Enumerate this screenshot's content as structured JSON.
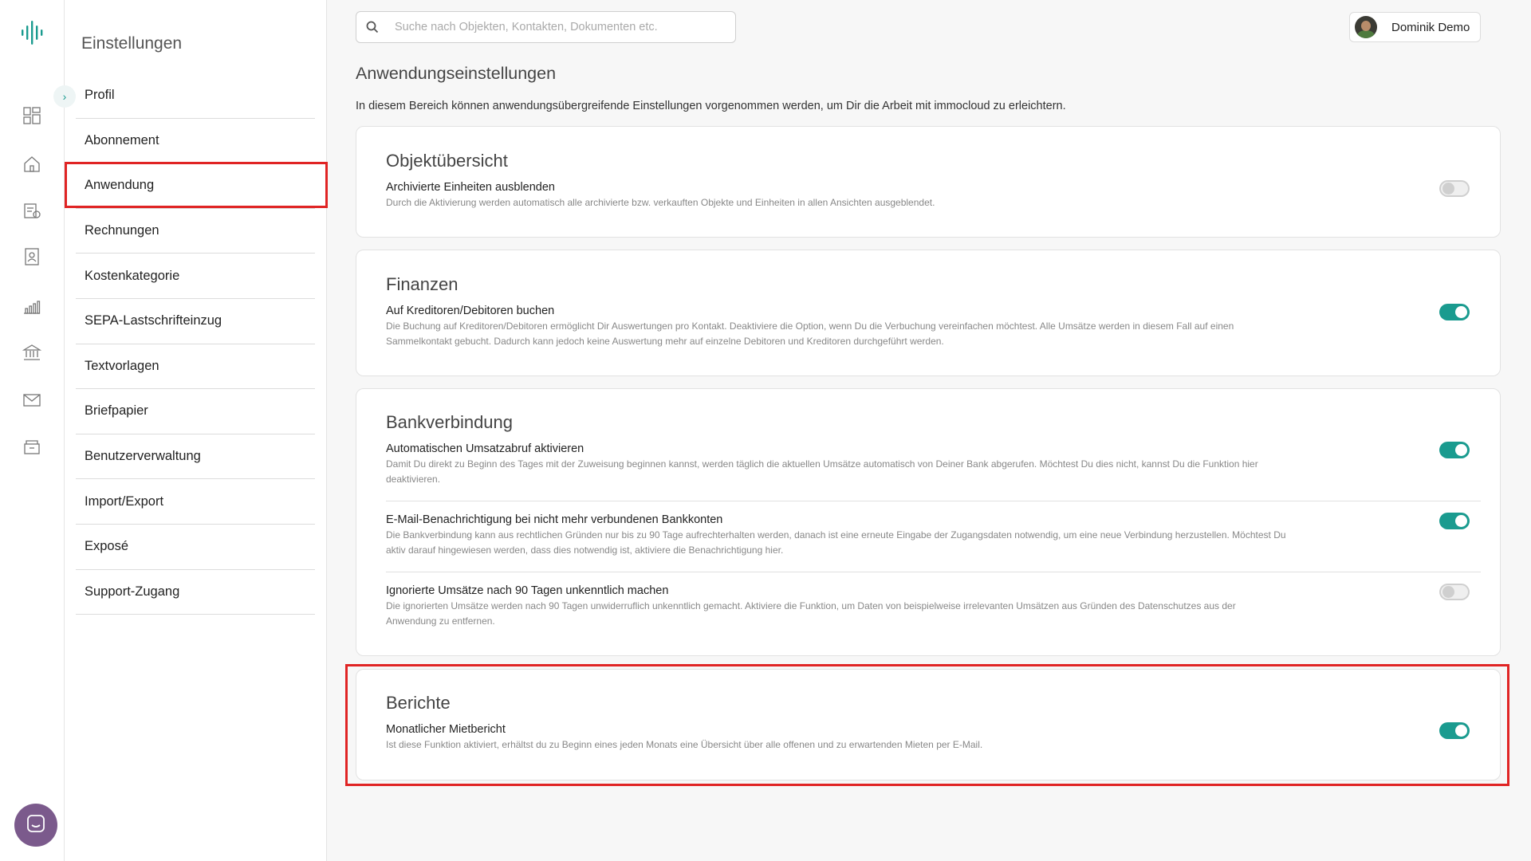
{
  "colors": {
    "accent": "#1a9b8f",
    "highlight": "#e02424"
  },
  "rail": {
    "logo": "immocloud-logo",
    "icons": [
      "dashboard-icon",
      "home-icon",
      "invoice-icon",
      "contacts-icon",
      "chart-icon",
      "bank-icon",
      "mail-icon",
      "archive-icon"
    ],
    "chat": "chat-icon"
  },
  "settings": {
    "title": "Einstellungen",
    "items": [
      {
        "label": "Profil"
      },
      {
        "label": "Abonnement"
      },
      {
        "label": "Anwendung"
      },
      {
        "label": "Rechnungen"
      },
      {
        "label": "Kostenkategorie"
      },
      {
        "label": "SEPA-Lastschrifteinzug"
      },
      {
        "label": "Textvorlagen"
      },
      {
        "label": "Briefpapier"
      },
      {
        "label": "Benutzerverwaltung"
      },
      {
        "label": "Import/Export"
      },
      {
        "label": "Exposé"
      },
      {
        "label": "Support-Zugang"
      }
    ]
  },
  "search": {
    "placeholder": "Suche nach Objekten, Kontakten, Dokumenten etc."
  },
  "user": {
    "name": "Dominik Demo"
  },
  "page": {
    "title": "Anwendungseinstellungen",
    "description": "In diesem Bereich können anwendungsübergreifende Einstellungen vorgenommen werden, um Dir die Arbeit mit immocloud zu erleichtern."
  },
  "cards": {
    "objekt": {
      "title": "Objektübersicht",
      "settings": [
        {
          "label": "Archivierte Einheiten ausblenden",
          "desc": "Durch die Aktivierung werden automatisch alle archivierte bzw. verkauften Objekte und Einheiten in allen Ansichten ausgeblendet.",
          "enabled": false
        }
      ]
    },
    "finanzen": {
      "title": "Finanzen",
      "settings": [
        {
          "label": "Auf Kreditoren/Debitoren buchen",
          "desc": "Die Buchung auf Kreditoren/Debitoren ermöglicht Dir Auswertungen pro Kontakt. Deaktiviere die Option, wenn Du die Verbuchung vereinfachen möchtest. Alle Umsätze werden in diesem Fall auf einen Sammelkontakt gebucht. Dadurch kann jedoch keine Auswertung mehr auf einzelne Debitoren und Kreditoren durchgeführt werden.",
          "enabled": true
        }
      ]
    },
    "bank": {
      "title": "Bankverbindung",
      "settings": [
        {
          "label": "Automatischen Umsatzabruf aktivieren",
          "desc": "Damit Du direkt zu Beginn des Tages mit der Zuweisung beginnen kannst, werden täglich die aktuellen Umsätze automatisch von Deiner Bank abgerufen. Möchtest Du dies nicht, kannst Du die Funktion hier deaktivieren.",
          "enabled": true
        },
        {
          "label": "E-Mail-Benachrichtigung bei nicht mehr verbundenen Bankkonten",
          "desc": "Die Bankverbindung kann aus rechtlichen Gründen nur bis zu 90 Tage aufrechterhalten werden, danach ist eine erneute Eingabe der Zugangsdaten notwendig, um eine neue Verbindung herzustellen. Möchtest Du aktiv darauf hingewiesen werden, dass dies notwendig ist, aktiviere die Benachrichtigung hier.",
          "enabled": true
        },
        {
          "label": "Ignorierte Umsätze nach 90 Tagen unkenntlich machen",
          "desc": "Die ignorierten Umsätze werden nach 90 Tagen unwiderruflich unkenntlich gemacht. Aktiviere die Funktion, um Daten von beispielweise irrelevanten Umsätzen aus Gründen des Datenschutzes aus der Anwendung zu entfernen.",
          "enabled": false
        }
      ]
    },
    "berichte": {
      "title": "Berichte",
      "settings": [
        {
          "label": "Monatlicher Mietbericht",
          "desc": "Ist diese Funktion aktiviert, erhältst du zu Beginn eines jeden Monats eine Übersicht über alle offenen und zu erwartenden Mieten per E-Mail.",
          "enabled": true
        }
      ]
    }
  }
}
